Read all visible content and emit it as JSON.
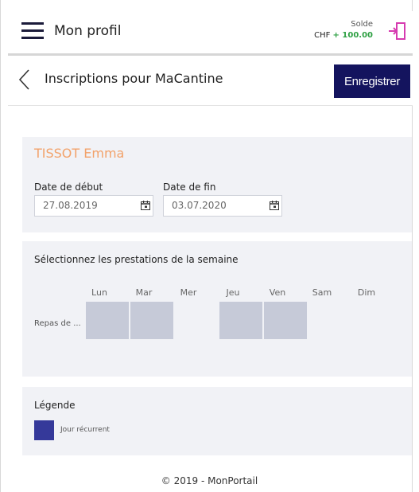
{
  "header": {
    "title": "Mon profil",
    "balance_label": "Solde",
    "balance_currency": "CHF",
    "balance_amount": "+ 100.00",
    "menu_icon": "hamburger-menu-icon",
    "logout_icon": "logout-door-icon"
  },
  "subheader": {
    "back_icon": "chevron-left-icon",
    "title": "Inscriptions pour MaCantine",
    "save_label": "Enregistrer"
  },
  "child": {
    "name": "TISSOT Emma",
    "start_label": "Date de début",
    "start_value": "27.08.2019",
    "end_label": "Date de fin",
    "end_value": "03.07.2020",
    "calendar_icon": "calendar-icon"
  },
  "services": {
    "title": "Sélectionnez les prestations de la semaine",
    "days": [
      "Lun",
      "Mar",
      "Mer",
      "Jeu",
      "Ven",
      "Sam",
      "Dim"
    ],
    "row_label": "Repas de ...",
    "available": [
      true,
      true,
      false,
      true,
      true,
      false,
      false
    ]
  },
  "legend": {
    "title": "Légende",
    "item_label": "Jour récurrent"
  },
  "footer": {
    "text": "© 2019 - MonPortail"
  },
  "colors": {
    "primary": "#14145e",
    "legend_swatch": "#35399a",
    "cell": "#c6cad8",
    "child_name": "#f2a26a",
    "balance_positive": "#2ea043",
    "logout_icon": "#d63bb0"
  }
}
